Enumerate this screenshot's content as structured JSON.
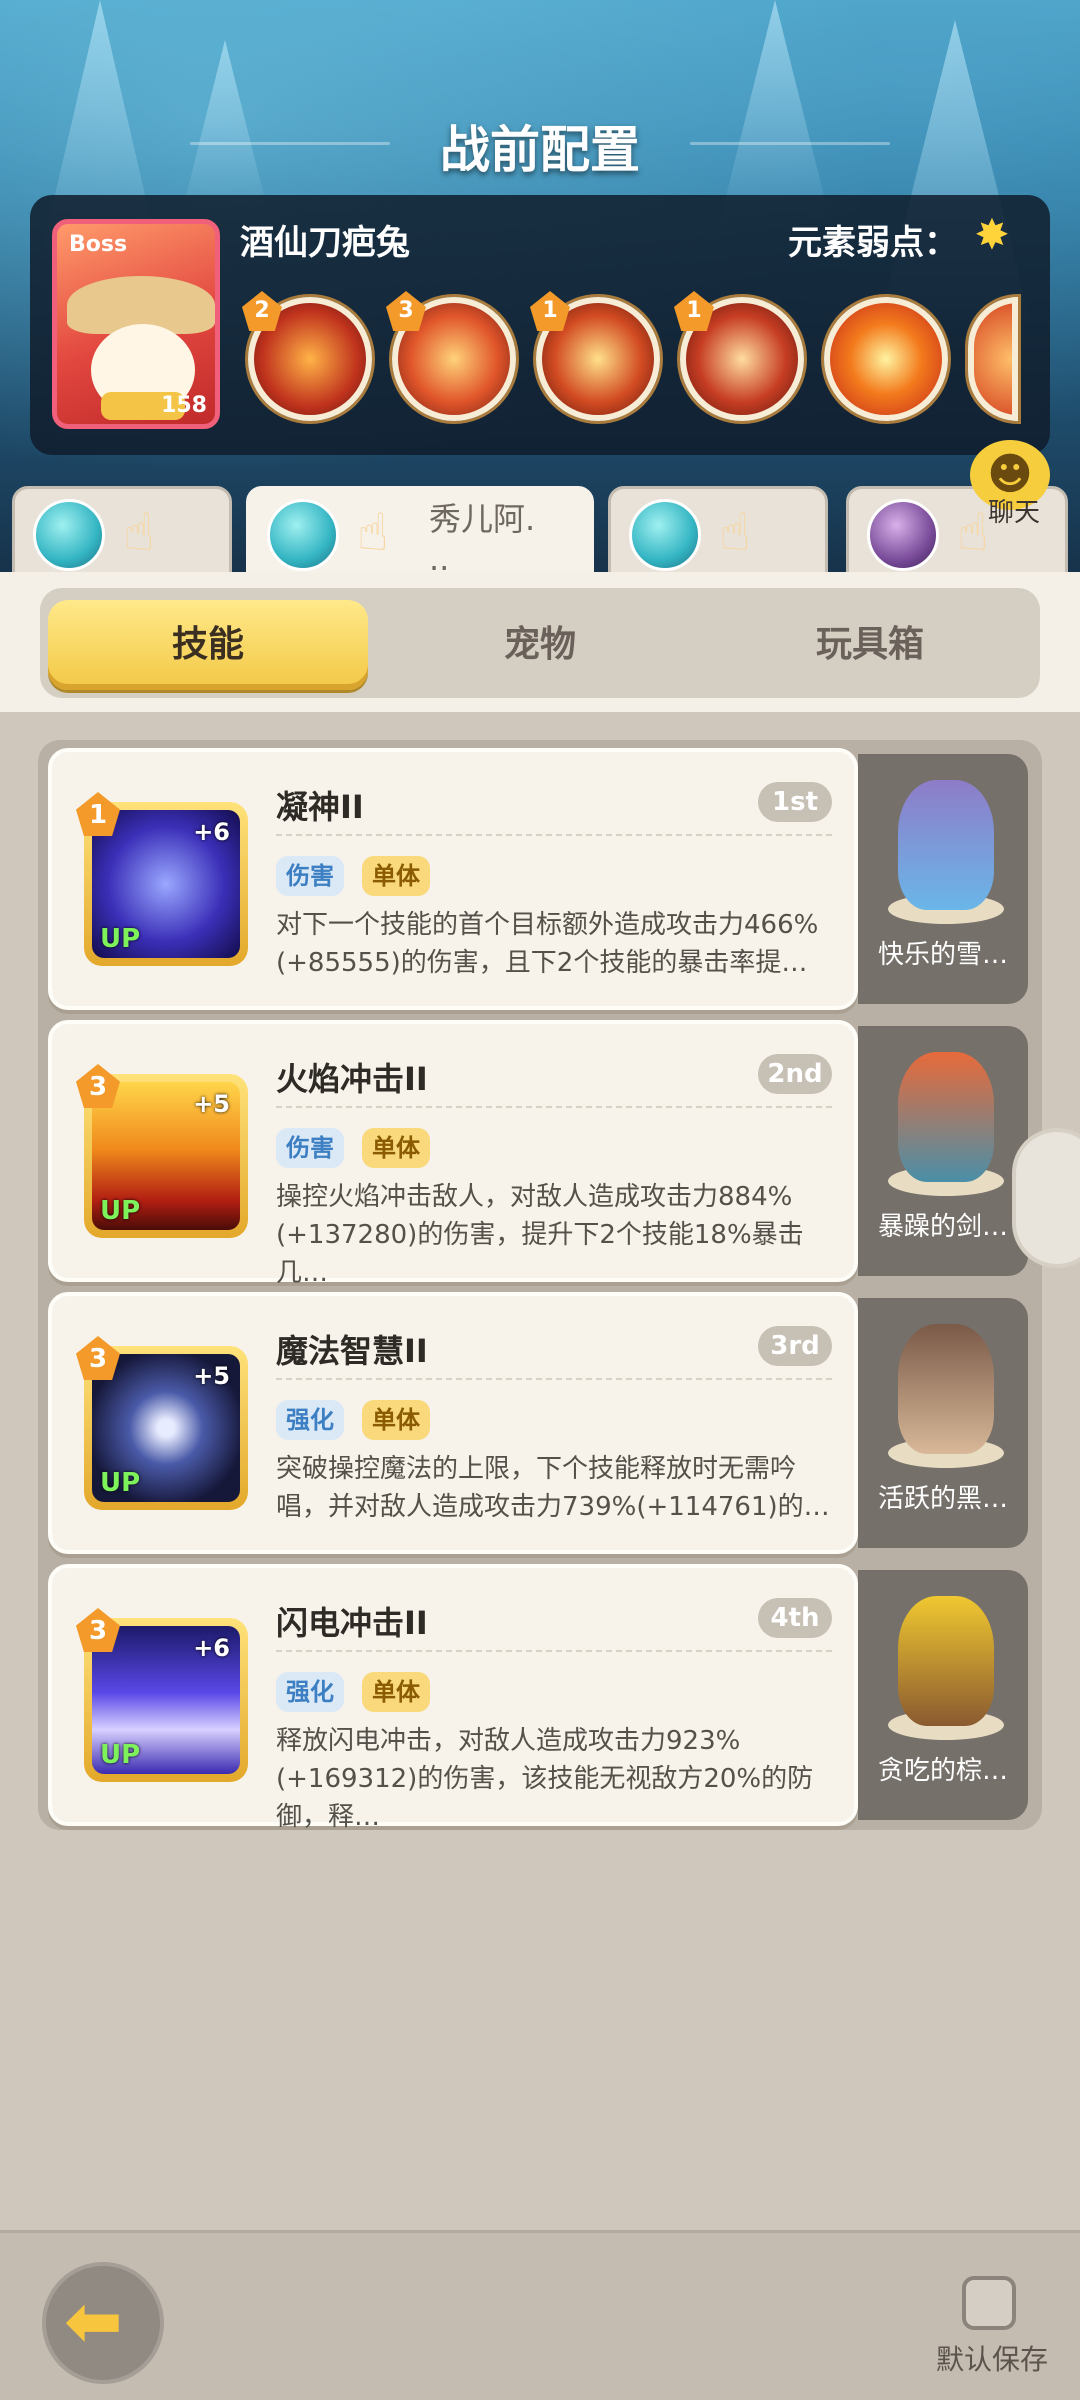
{
  "header": {
    "title": "战前配置",
    "boss_tag": "Boss",
    "boss_name": "酒仙刀疤兔",
    "boss_level": "158",
    "weak_label": "元素弱点：",
    "weak_icon": "star-burst-icon",
    "boss_skills": [
      {
        "level": "2",
        "icon": "dark-rune-skill-icon"
      },
      {
        "level": "3",
        "icon": "fire-slash-skill-icon"
      },
      {
        "level": "1",
        "icon": "spark-skill-icon"
      },
      {
        "level": "1",
        "icon": "swirl-strike-skill-icon"
      },
      {
        "level": "",
        "icon": "explosion-skill-icon"
      }
    ]
  },
  "team": {
    "slots": [
      {
        "name": "",
        "active": false
      },
      {
        "name": "秀儿阿.\n..",
        "active": true
      },
      {
        "name": "",
        "active": false
      },
      {
        "name": "",
        "active": false
      }
    ],
    "chat_label": "聊天"
  },
  "tabs": [
    {
      "label": "技能",
      "active": true
    },
    {
      "label": "宠物",
      "active": false
    },
    {
      "label": "玩具箱",
      "active": false
    }
  ],
  "skills": [
    {
      "level": "1",
      "plus": "+6",
      "up": "UP",
      "name": "凝神II",
      "order": "1st",
      "type_tag": "伤害",
      "target_tag": "单体",
      "desc": "对下一个技能的首个目标额外造成攻击力466%(+85555)的伤害，且下2个技能的暴击率提…",
      "pet_name": "快乐的雪…"
    },
    {
      "level": "3",
      "plus": "+5",
      "up": "UP",
      "name": "火焰冲击II",
      "order": "2nd",
      "type_tag": "伤害",
      "target_tag": "单体",
      "desc": "操控火焰冲击敌人，对敌人造成攻击力884%(+137280)的伤害，提升下2个技能18%暴击几…",
      "pet_name": "暴躁的剑…"
    },
    {
      "level": "3",
      "plus": "+5",
      "up": "UP",
      "name": "魔法智慧II",
      "order": "3rd",
      "type_tag": "强化",
      "target_tag": "单体",
      "desc": "突破操控魔法的上限，下个技能释放时无需吟唱，并对敌人造成攻击力739%(+114761)的…",
      "pet_name": "活跃的黑…"
    },
    {
      "level": "3",
      "plus": "+6",
      "up": "UP",
      "name": "闪电冲击II",
      "order": "4th",
      "type_tag": "强化",
      "target_tag": "单体",
      "desc": "释放闪电冲击，对敌人造成攻击力923%(+169312)的伤害，该技能无视敌方20%的防御，释…",
      "pet_name": "贪吃的棕…"
    }
  ],
  "footer": {
    "back_icon": "arrow-left-icon",
    "save_label": "默认保存"
  }
}
